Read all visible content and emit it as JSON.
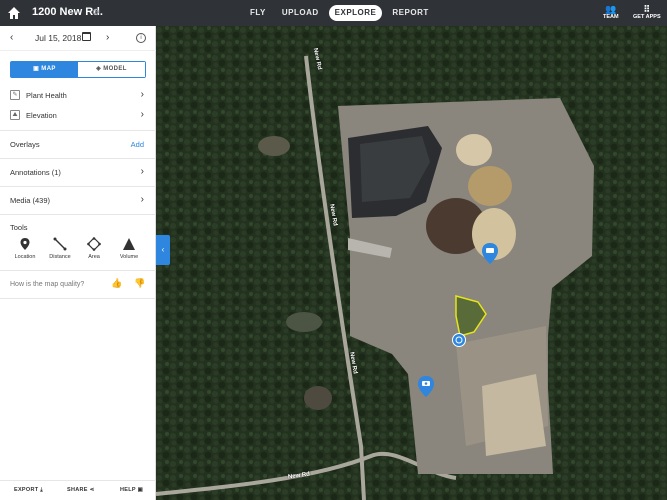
{
  "header": {
    "project_name": "1200 New Rd.",
    "nav": [
      "FLY",
      "UPLOAD",
      "EXPLORE",
      "REPORT"
    ],
    "active_nav": "EXPLORE",
    "team_label": "TEAM",
    "apps_label": "GET APPS"
  },
  "date_bar": {
    "date": "Jul 15, 2018"
  },
  "view_toggle": {
    "map": "MAP",
    "model": "MODEL"
  },
  "layers": [
    {
      "label": "Plant Health",
      "icon": "plant-health-icon"
    },
    {
      "label": "Elevation",
      "icon": "elevation-icon"
    }
  ],
  "overlays": {
    "label": "Overlays",
    "add": "Add"
  },
  "annotations": {
    "label": "Annotations (1)"
  },
  "media": {
    "label": "Media (439)"
  },
  "tools": {
    "title": "Tools",
    "items": [
      "Location",
      "Distance",
      "Area",
      "Volume"
    ]
  },
  "quality": {
    "question": "How is the map quality?"
  },
  "footer": {
    "export": "EXPORT",
    "share": "SHARE",
    "help": "HELP"
  },
  "map": {
    "road_labels": [
      "New Rd",
      "New Rd",
      "New Rd",
      "New Rd"
    ],
    "colors": {
      "forest": "#23321f",
      "orthomosaic": "#8a857d",
      "accent": "#2e86de",
      "annotation": "#e5e51a"
    }
  }
}
